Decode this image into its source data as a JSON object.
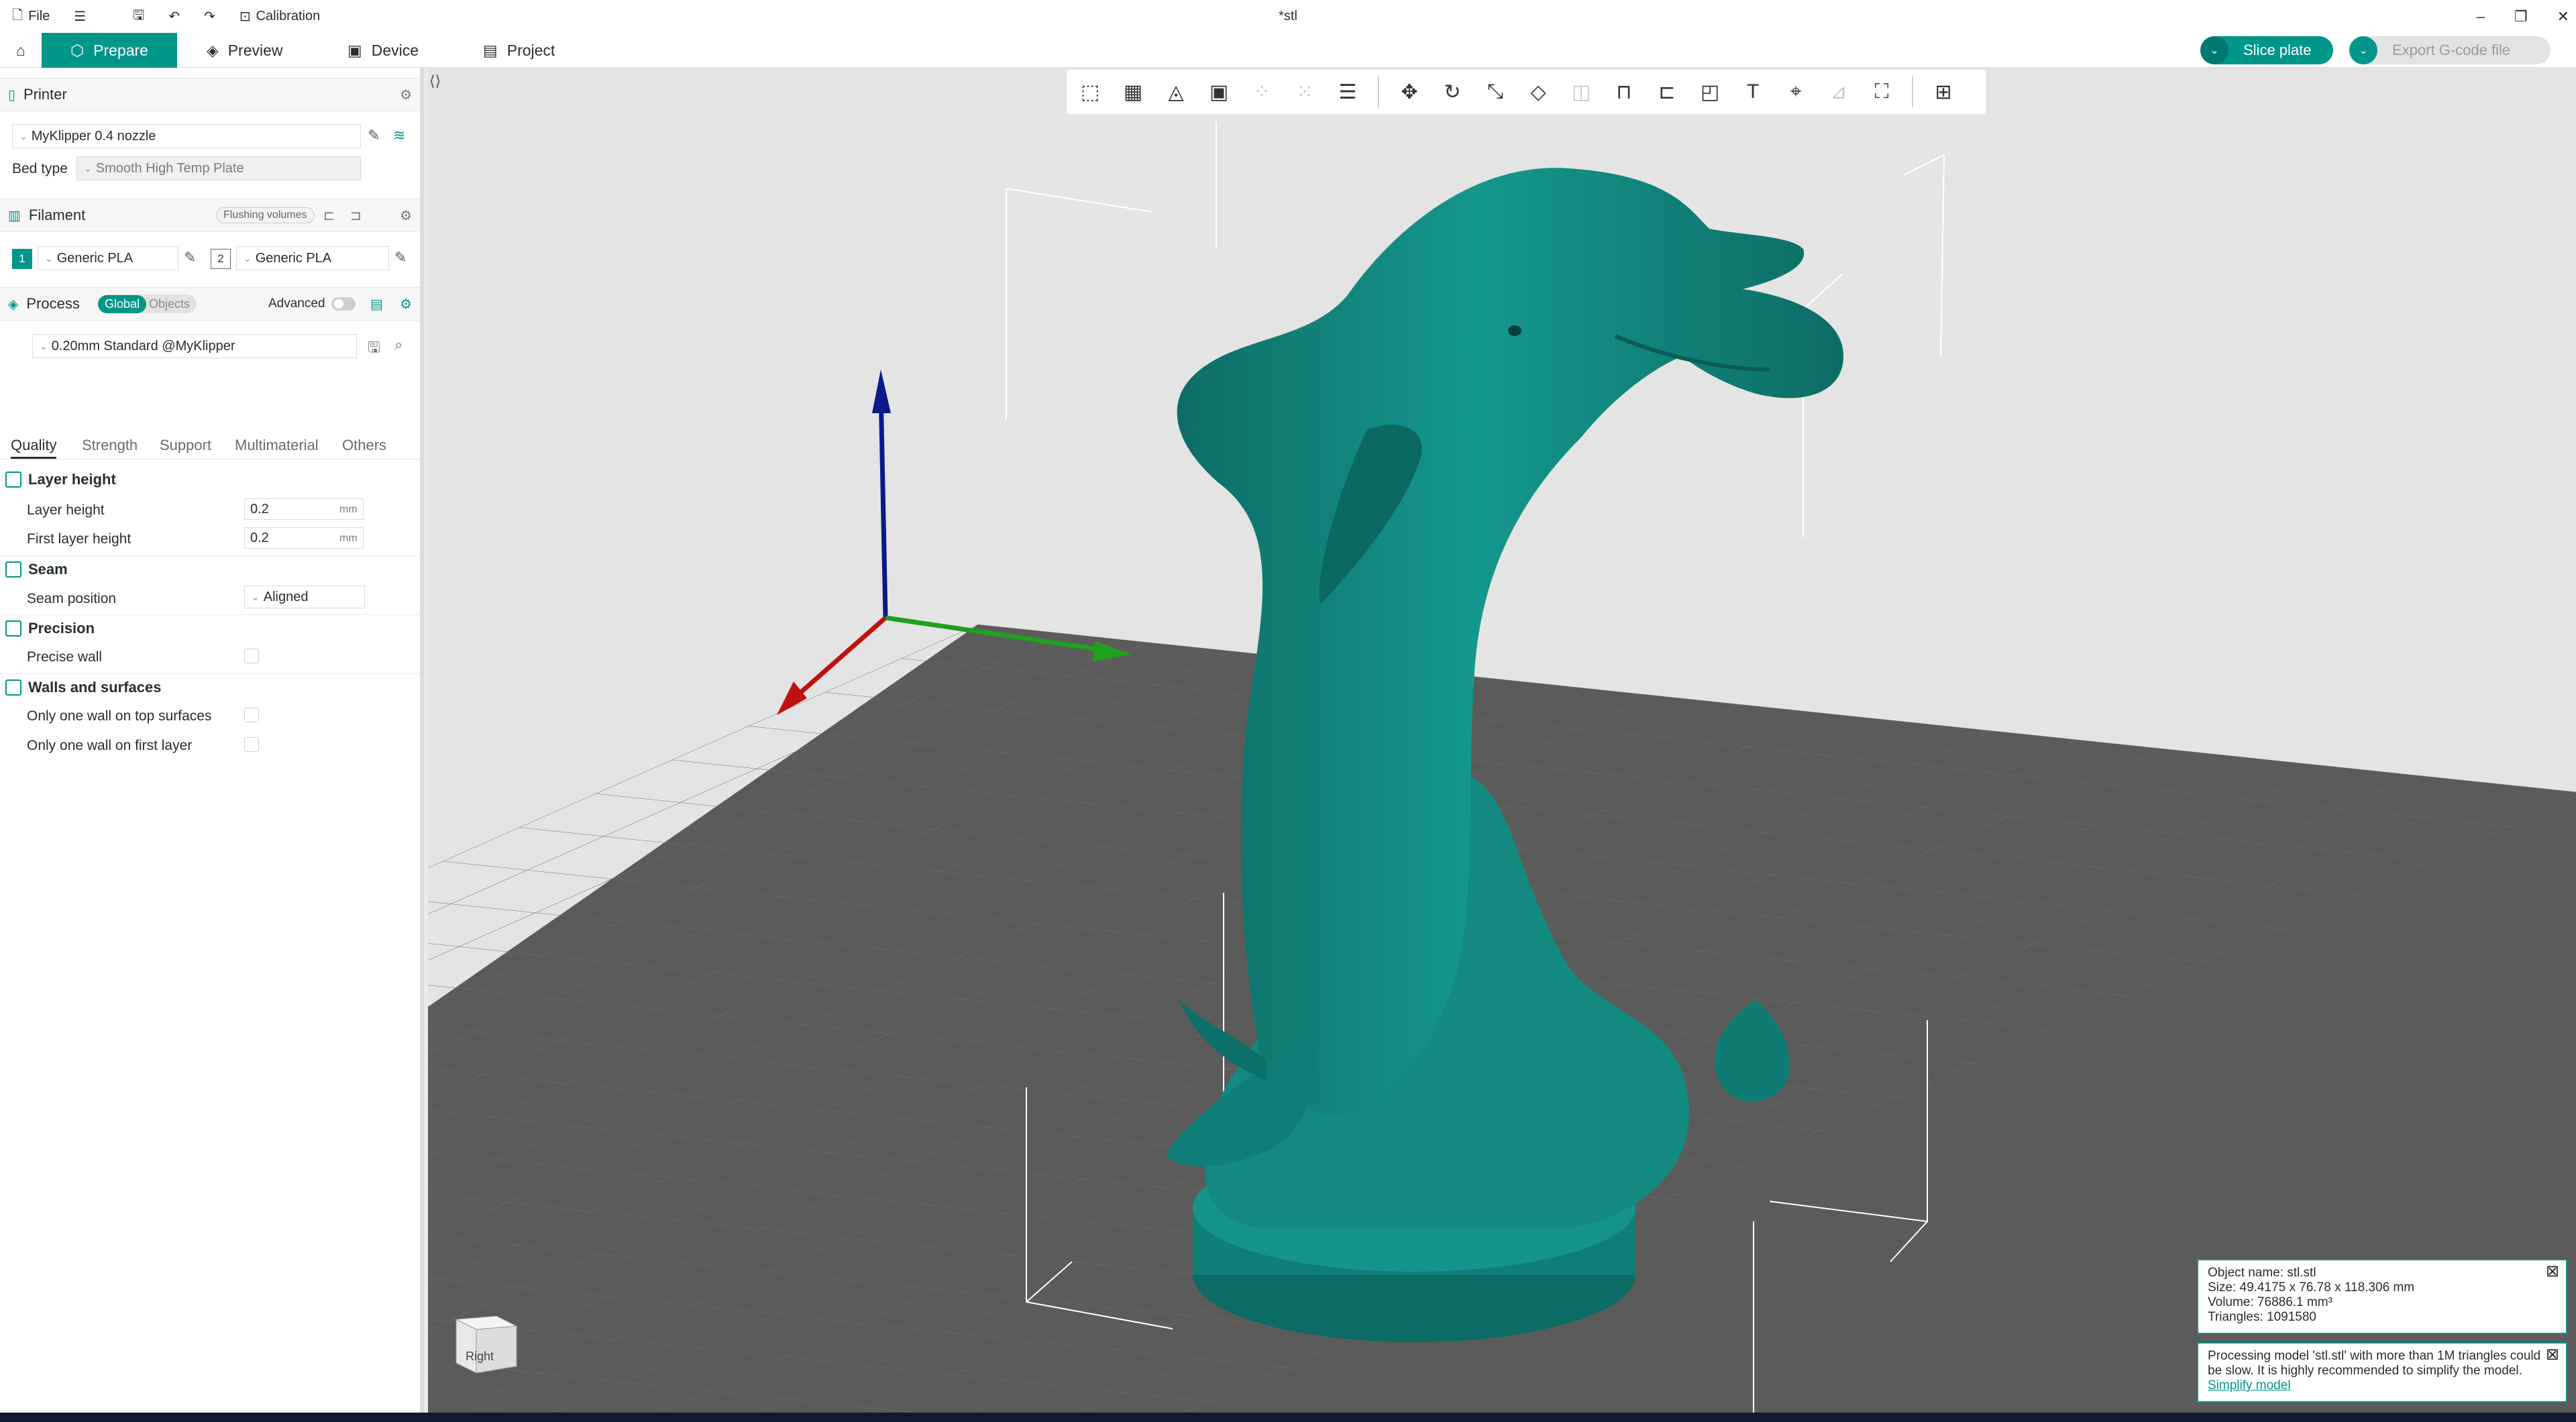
{
  "titlebar": {
    "file_label": "File",
    "calibration_label": "Calibration",
    "title": "*stl"
  },
  "tabs": {
    "prepare": "Prepare",
    "preview": "Preview",
    "device": "Device",
    "project": "Project"
  },
  "actions": {
    "slice_plate": "Slice plate",
    "export_gcode": "Export G-code file"
  },
  "printer": {
    "section_title": "Printer",
    "name": "MyKlipper 0.4 nozzle",
    "bed_type_label": "Bed type",
    "bed_type_value": "Smooth High Temp Plate"
  },
  "filament": {
    "section_title": "Filament",
    "flushing_label": "Flushing volumes",
    "slots": [
      {
        "index": "1",
        "name": "Generic PLA",
        "color": "#00968a"
      },
      {
        "index": "2",
        "name": "Generic PLA",
        "color": "#ffffff"
      }
    ]
  },
  "process": {
    "section_title": "Process",
    "toggle_global": "Global",
    "toggle_objects": "Objects",
    "advanced_label": "Advanced",
    "preset": "0.20mm Standard @MyKlipper",
    "tabs": [
      "Quality",
      "Strength",
      "Support",
      "Multimaterial",
      "Others"
    ],
    "active_tab": "Quality"
  },
  "quality": {
    "layer_height_group": "Layer height",
    "layer_height_label": "Layer height",
    "layer_height_value": "0.2",
    "first_layer_height_label": "First layer height",
    "first_layer_height_value": "0.2",
    "unit": "mm",
    "seam_group": "Seam",
    "seam_position_label": "Seam position",
    "seam_position_value": "Aligned",
    "precision_group": "Precision",
    "precise_wall_label": "Precise wall",
    "walls_group": "Walls and surfaces",
    "one_wall_top_label": "Only one wall on top surfaces",
    "one_wall_first_label": "Only one wall on first layer"
  },
  "navcube": {
    "face_label": "Right"
  },
  "object_info": {
    "name": "Object name: stl.stl",
    "size": "Size: 49.4175 x 76.78 x 118.306 mm",
    "volume": "Volume: 76886.1 mm³",
    "triangles": "Triangles: 1091580"
  },
  "warning": {
    "text": "Processing model 'stl.stl' with more than 1M triangles could be slow. It is highly recommended to simplify the model.",
    "link": "Simplify model"
  },
  "colors": {
    "accent": "#00968a",
    "model": "#11857c",
    "bed": "#5b5b5b",
    "axis_x": "#c01010",
    "axis_y": "#1fa01f",
    "axis_z": "#0a1a8a"
  }
}
